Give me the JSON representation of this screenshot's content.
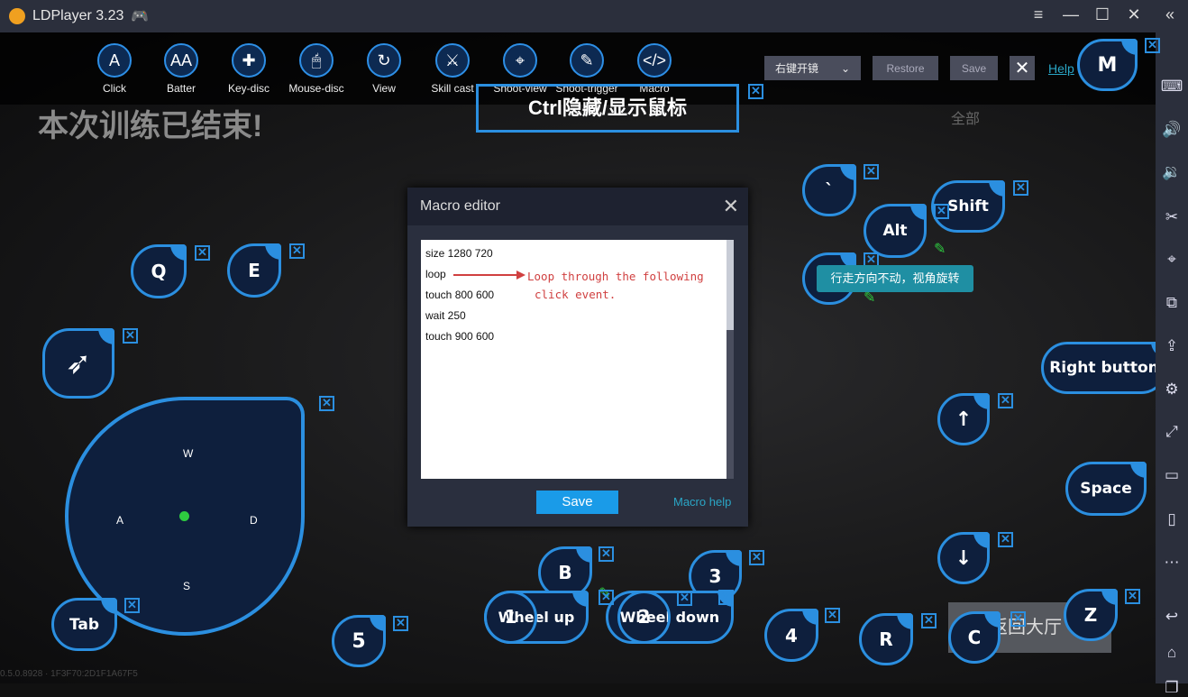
{
  "window": {
    "title": "LDPlayer 3.23",
    "controls": [
      "≡",
      "—",
      "☐",
      "✕",
      "«"
    ]
  },
  "toolbar": {
    "items": [
      {
        "label": "Click",
        "glyph": "A",
        "icon": "click-icon"
      },
      {
        "label": "Batter",
        "glyph": "AA",
        "icon": "batter-icon"
      },
      {
        "label": "Key-disc",
        "glyph": "✚",
        "icon": "key-disc-icon"
      },
      {
        "label": "Mouse-disc",
        "glyph": "🖱",
        "icon": "mouse-icon"
      },
      {
        "label": "View",
        "glyph": "↻",
        "icon": "view-rotate-icon"
      },
      {
        "label": "Skill cast",
        "glyph": "⚔",
        "icon": "sword-icon"
      },
      {
        "label": "Shoot-view",
        "glyph": "⌖",
        "icon": "crosshair-icon"
      },
      {
        "label": "Shoot-trigger",
        "glyph": "✎",
        "icon": "trigger-icon"
      },
      {
        "label": "Macro",
        "glyph": "</>",
        "icon": "macro-script-icon"
      }
    ],
    "dropdown_value": "右键开镜",
    "restore": "Restore",
    "save": "Save",
    "close": "✕",
    "help": "Help"
  },
  "scene": {
    "banner": "本次训练已结束!",
    "ctrl_hint": "Ctrl隐藏/显示鼠标",
    "all_label": "全部",
    "back_lobby": "返回大厅",
    "version": "0.5.0.8928 · 1F3F70:2D1F1A67F5"
  },
  "keys": {
    "m": "M",
    "backtick": "`",
    "shift": "Shift",
    "alt": "Alt",
    "tooltip": "行走方向不动，视角旋转",
    "q": "Q",
    "e": "E",
    "right_button": "Right button",
    "up": "↑",
    "down": "↓",
    "space": "Space",
    "tab": "Tab",
    "five": "5",
    "b": "B",
    "one": "1",
    "wheel_up": "Wheel up",
    "three": "3",
    "two": "2",
    "wheel_down": "Wheel down",
    "four": "4",
    "r": "R",
    "c": "C",
    "z": "Z"
  },
  "joystick": {
    "up": "W",
    "left": "A",
    "right": "D",
    "down": "S"
  },
  "macro_editor": {
    "title": "Macro editor",
    "lines": [
      "size 1280 720",
      "loop",
      "touch 800 600",
      "wait 250",
      "touch 900 600"
    ],
    "annotation": [
      "Loop through the following",
      "click event."
    ],
    "save": "Save",
    "help": "Macro help"
  },
  "sidebar": {
    "icons": [
      "keyboard-icon",
      "volume-up-icon",
      "volume-down-icon",
      "scissors-icon",
      "location-icon",
      "multi-window-icon",
      "apk-install-icon",
      "settings-icon",
      "fullscreen-icon",
      "screen-icon",
      "shake-icon",
      "more-icon",
      "back-icon",
      "home-icon",
      "recent-apps-icon"
    ]
  },
  "colors": {
    "accent": "#2b8fe0",
    "save_button": "#1a9be8",
    "tooltip": "#1f8fa3",
    "annotation": "#d04040"
  }
}
